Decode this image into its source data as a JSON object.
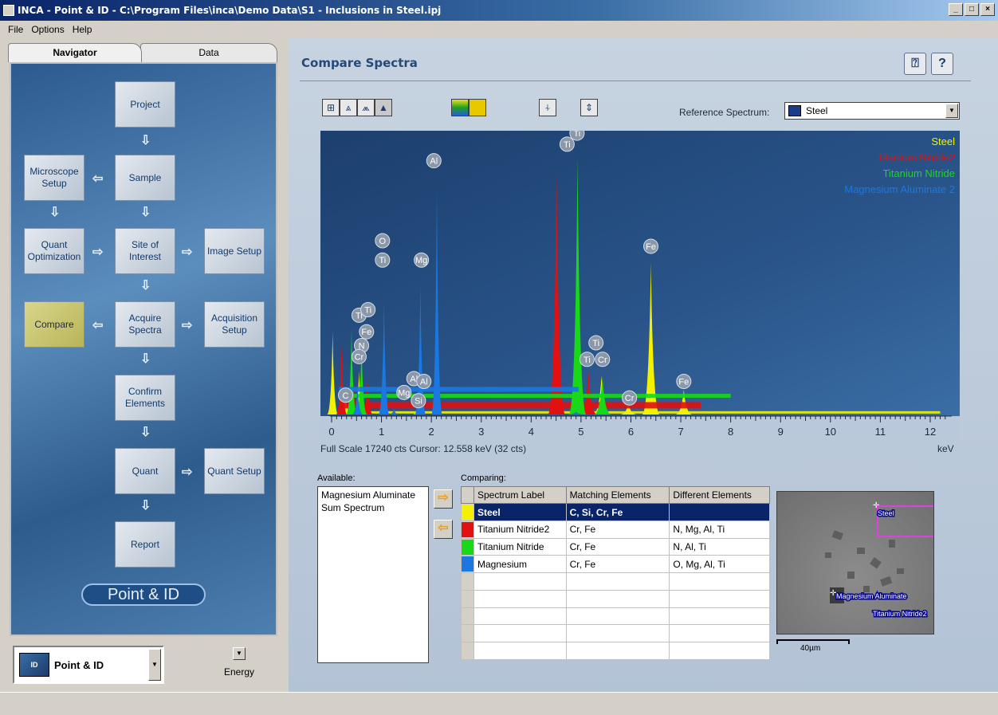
{
  "window": {
    "title": "INCA - Point & ID - C:\\Program Files\\inca\\Demo Data\\S1 - Inclusions in Steel.ipj"
  },
  "menu": [
    "File",
    "Options",
    "Help"
  ],
  "left": {
    "tabs": [
      "Navigator",
      "Data"
    ],
    "nav": {
      "project": "Project",
      "sample": "Sample",
      "microscope_setup": "Microscope Setup",
      "quant_optimization": "Quant Optimization",
      "site_of_interest": "Site of Interest",
      "image_setup": "Image Setup",
      "compare": "Compare",
      "acquire_spectra": "Acquire Spectra",
      "acquisition_setup": "Acquisition Setup",
      "confirm_elements": "Confirm Elements",
      "quant": "Quant",
      "quant_setup": "Quant Setup",
      "report": "Report"
    },
    "module_banner": "Point & ID",
    "module_select": "Point & ID",
    "energy_label": "Energy"
  },
  "main": {
    "title": "Compare Spectra",
    "reference_label": "Reference Spectrum:",
    "reference_value": "Steel",
    "status_line": "Full Scale 17240 cts  Cursor: 12.558 keV (32 cts)",
    "unit": "keV",
    "available_label": "Available:",
    "available_items": [
      "Magnesium Aluminate",
      "Sum Spectrum"
    ],
    "comparing_label": "Comparing:",
    "table": {
      "headers": [
        "Spectrum Label",
        "Matching Elements",
        "Different Elements"
      ],
      "rows": [
        {
          "color": "#f2f200",
          "label": "Steel",
          "matching": "C, Si, Cr, Fe",
          "different": ""
        },
        {
          "color": "#e21010",
          "label": "Titanium Nitride2",
          "matching": "Cr, Fe",
          "different": "N, Mg, Al, Ti"
        },
        {
          "color": "#18d818",
          "label": "Titanium Nitride",
          "matching": "Cr, Fe",
          "different": "N, Al, Ti"
        },
        {
          "color": "#1a78e0",
          "label": "Magnesium",
          "matching": "Cr, Fe",
          "different": "O, Mg, Al, Ti"
        }
      ]
    },
    "thumbnail": {
      "labels": [
        "Steel",
        "Magnesium Aluminate",
        "Titanium Nitride2"
      ],
      "scale": "40µm"
    }
  },
  "chart_data": {
    "type": "line",
    "xlabel": "keV",
    "xlim": [
      0,
      12.4
    ],
    "x_ticks": [
      0,
      1,
      2,
      3,
      4,
      5,
      6,
      7,
      8,
      9,
      10,
      11,
      12
    ],
    "full_scale_cts": 17240,
    "cursor_kev": 12.558,
    "cursor_cts": 32,
    "legend_placement": "top-right",
    "series": [
      {
        "name": "Steel",
        "color": "#f2f200",
        "peaks": [
          [
            0.02,
            0.3
          ],
          [
            0.28,
            0.09
          ],
          [
            0.55,
            0.16
          ],
          [
            1.74,
            0.05
          ],
          [
            5.41,
            0.14
          ],
          [
            5.95,
            0.04
          ],
          [
            6.4,
            0.55
          ],
          [
            7.06,
            0.09
          ]
        ]
      },
      {
        "name": "Titanium Nitride2",
        "color": "#e21010",
        "peaks": [
          [
            0.2,
            0.26
          ],
          [
            0.45,
            0.1
          ],
          [
            0.72,
            0.14
          ],
          [
            4.51,
            0.88
          ],
          [
            5.15,
            0.16
          ]
        ]
      },
      {
        "name": "Titanium Nitride",
        "color": "#18d818",
        "peaks": [
          [
            0.4,
            0.31
          ],
          [
            0.6,
            0.26
          ],
          [
            4.93,
            0.93
          ],
          [
            5.43,
            0.14
          ]
        ]
      },
      {
        "name": "Magnesium Aluminate 2",
        "color": "#1a78e0",
        "peaks": [
          [
            0.52,
            0.1
          ],
          [
            1.05,
            0.41
          ],
          [
            1.25,
            0.02
          ],
          [
            1.78,
            0.47
          ],
          [
            2.11,
            0.82
          ],
          [
            4.9,
            0.01
          ]
        ]
      }
    ],
    "peak_labels": [
      {
        "text": "Al",
        "x": 2.05,
        "y": 0.92
      },
      {
        "text": "Ti",
        "x": 4.72,
        "y": 0.98
      },
      {
        "text": "Ti",
        "x": 4.92,
        "y": 1.02
      },
      {
        "text": "O",
        "x": 1.02,
        "y": 0.63
      },
      {
        "text": "Ti",
        "x": 1.02,
        "y": 0.56
      },
      {
        "text": "Mg",
        "x": 1.8,
        "y": 0.56
      },
      {
        "text": "Fe",
        "x": 6.4,
        "y": 0.61
      },
      {
        "text": "Ti",
        "x": 0.55,
        "y": 0.36
      },
      {
        "text": "Ti",
        "x": 0.73,
        "y": 0.38
      },
      {
        "text": "Fe",
        "x": 0.7,
        "y": 0.3
      },
      {
        "text": "N",
        "x": 0.6,
        "y": 0.25
      },
      {
        "text": "Cr",
        "x": 0.55,
        "y": 0.21
      },
      {
        "text": "C",
        "x": 0.28,
        "y": 0.07
      },
      {
        "text": "Al",
        "x": 1.65,
        "y": 0.13
      },
      {
        "text": "Al",
        "x": 1.85,
        "y": 0.12
      },
      {
        "text": "Mg",
        "x": 1.45,
        "y": 0.08
      },
      {
        "text": "Si",
        "x": 1.74,
        "y": 0.05
      },
      {
        "text": "Ti",
        "x": 5.3,
        "y": 0.26
      },
      {
        "text": "Ti",
        "x": 5.12,
        "y": 0.2
      },
      {
        "text": "Cr",
        "x": 5.43,
        "y": 0.2
      },
      {
        "text": "Cr",
        "x": 5.97,
        "y": 0.06
      },
      {
        "text": "Fe",
        "x": 7.06,
        "y": 0.12
      }
    ]
  }
}
